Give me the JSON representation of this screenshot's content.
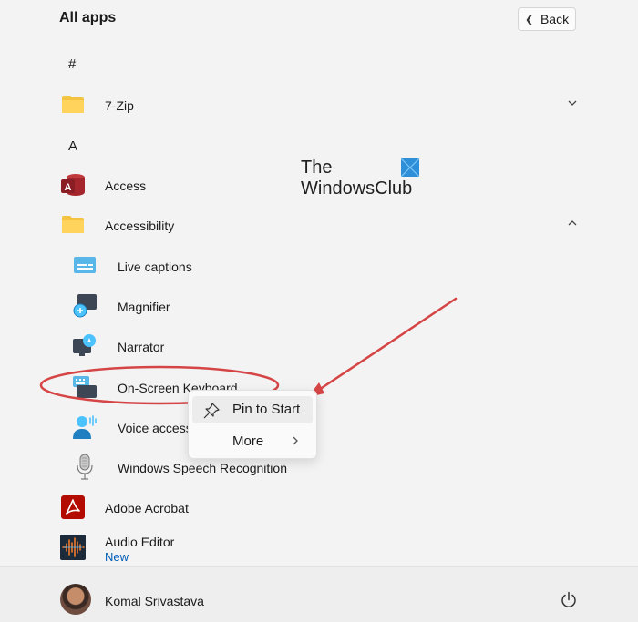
{
  "header": {
    "title": "All apps",
    "back_label": "Back"
  },
  "groups": {
    "hash": "#",
    "a": "A"
  },
  "apps": {
    "zip": {
      "name": "7-Zip"
    },
    "access": {
      "name": "Access"
    },
    "accessibility": {
      "name": "Accessibility"
    },
    "live_captions": {
      "name": "Live captions"
    },
    "magnifier": {
      "name": "Magnifier"
    },
    "narrator": {
      "name": "Narrator"
    },
    "osk": {
      "name": "On-Screen Keyboard"
    },
    "voice_access": {
      "name": "Voice access"
    },
    "speech": {
      "name": "Windows Speech Recognition"
    },
    "acrobat": {
      "name": "Adobe Acrobat"
    },
    "audio_editor": {
      "name": "Audio Editor",
      "badge": "New"
    }
  },
  "logo": {
    "line1": "The",
    "line2": "WindowsClub"
  },
  "context_menu": {
    "pin_label": "Pin to Start",
    "more_label": "More"
  },
  "footer": {
    "user_name": "Komal Srivastava"
  },
  "colors": {
    "accent": "#005fb8",
    "annotation": "#d64545",
    "folder": "#f5c342"
  }
}
